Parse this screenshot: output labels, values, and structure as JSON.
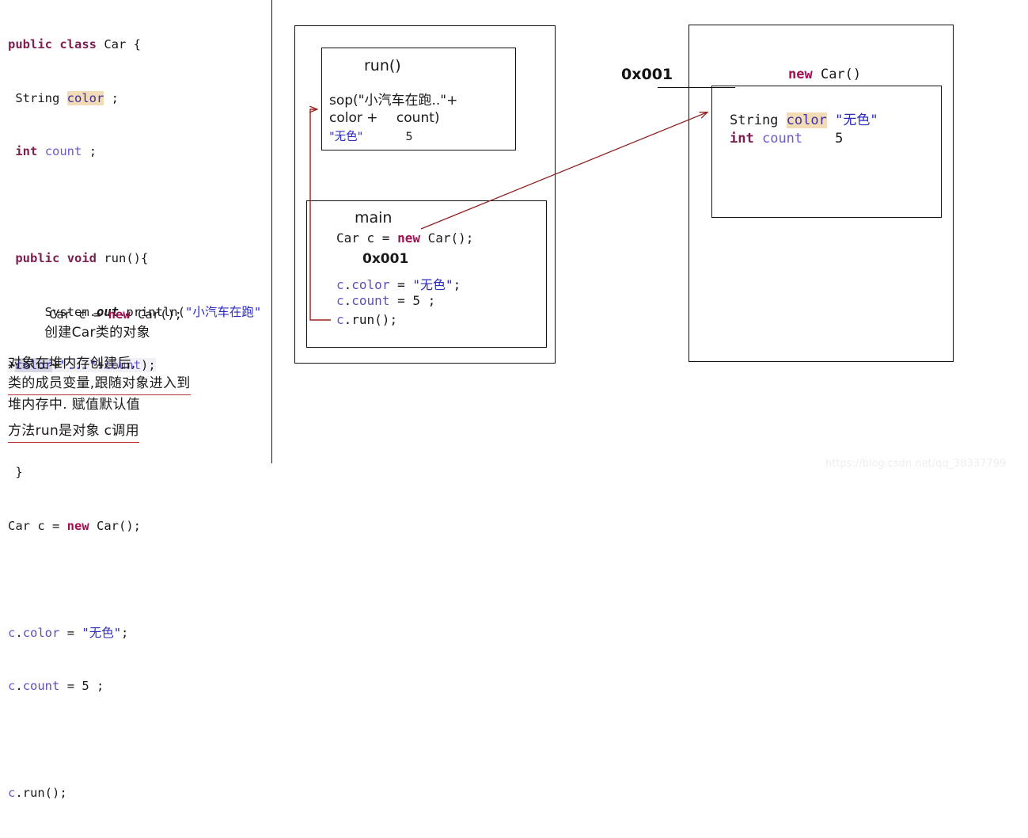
{
  "code_panel": {
    "lines": [
      "public class Car {",
      " String color ;",
      " int count ;",
      "",
      " public void run(){",
      "     System.out.println(\"小汽车在跑\"",
      "+color+\"...\"+count);",
      "",
      " }",
      "Car c = new Car();",
      "",
      "c.color = \"无色\";",
      "c.count = 5 ;",
      "",
      "c.run();"
    ],
    "tokens": {
      "kw_public": "public",
      "kw_class": "class",
      "kw_string": "String",
      "kw_int": "int",
      "kw_void": "void",
      "kw_new": "new",
      "name_car": "Car",
      "name_color": "color",
      "name_count": "count",
      "name_run": "run",
      "name_system": "System",
      "name_out": "out",
      "name_println": "println",
      "str_running": "\"小汽车在跑\"",
      "str_dots": "\"...\"",
      "str_wuse": "\"无色\"",
      "val_five": "5"
    }
  },
  "notes": {
    "code_line": "Car c = new Car();",
    "line1": "创建Car类的对象",
    "line2": "对象在堆内存创建后,",
    "line3": "类的成员变量,跟随对象进入到",
    "line4": "堆内存中. 赋值默认值",
    "line5": "方法run是对象 c调用"
  },
  "diagram": {
    "stack": {
      "run_frame": {
        "title": "run()",
        "line1": "sop(\"小汽车在跑..\"+",
        "line2_a": "color + ",
        "line2_b": "count)",
        "line3_a": "\"无色\"",
        "line3_b": "5"
      },
      "main_frame": {
        "title": "main",
        "line1": "Car c = new Car();",
        "address": "0x001",
        "line3": "c.color = \"无色\";",
        "line4": "c.count = 5 ;",
        "line5": "c.run();"
      }
    },
    "heap": {
      "title_new": "new",
      "title_car": "Car()",
      "address_label": "0x001",
      "object": {
        "field1_type": "String",
        "field1_name": "color",
        "field1_value": "\"无色\"",
        "field2_type": "int",
        "field2_name": "count",
        "field2_value": "5"
      }
    }
  },
  "watermark": "https://blog.csdn.net/qq_38337799",
  "colors": {
    "keyword": "#7d1f4f",
    "variable": "#3b2f9e",
    "string": "#2b2bbd",
    "arrow": "#9b2020",
    "highlight_tan": "#f2dcb8",
    "highlight_gray": "#d6d6e4",
    "underline_red": "#b03030",
    "border": "#111111"
  }
}
